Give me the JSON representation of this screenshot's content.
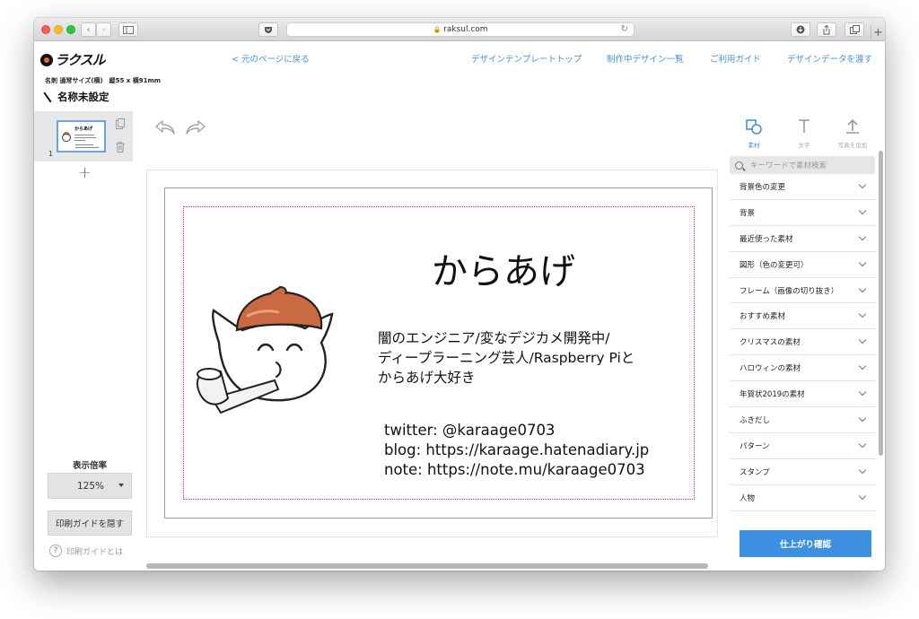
{
  "browser": {
    "url": "raksul.com"
  },
  "header": {
    "logo_text": "ラクスル",
    "back_link": "< 元のページに戻る",
    "nav": [
      "デザインテンプレートトップ",
      "制作中デザイン一覧",
      "ご利用ガイド",
      "デザインデータを渡す"
    ],
    "product": "名刺 通常サイズ(横)　縦55 x 横91mm",
    "design_title": "名称未設定"
  },
  "pages": {
    "thumb_title": "からあげ",
    "page_number": "1",
    "add_symbol": "+"
  },
  "zoom": {
    "label": "表示倍率",
    "value": "125%"
  },
  "guide": {
    "hide_button": "印刷ガイドを隠す",
    "help_link": "印刷ガイドとは"
  },
  "card": {
    "title": "からあげ",
    "bio": [
      "闇のエンジニア/変なデジカメ開発中/",
      "ディープラーニング芸人/Raspberry Piと",
      "からあげ大好き"
    ],
    "links": [
      "twitter: @karaage0703",
      "blog: https://karaage.hatenadiary.jp",
      "note: https://note.mu/karaage0703"
    ]
  },
  "right_panel": {
    "tabs": [
      {
        "label": "素材",
        "icon": "shapes-icon",
        "active": true
      },
      {
        "label": "文字",
        "icon": "text-icon",
        "active": false
      },
      {
        "label": "写真を追加",
        "icon": "upload-icon",
        "active": false
      }
    ],
    "search_placeholder": "キーワードで素材検索",
    "categories": [
      "背景色の変更",
      "背景",
      "最近使った素材",
      "図形（色の変更可）",
      "フレーム（画像の切り抜き）",
      "おすすめ素材",
      "クリスマスの素材",
      "ハロウィンの素材",
      "年賀状2019の素材",
      "ふきだし",
      "パターン",
      "スタンプ",
      "人物"
    ],
    "confirm_button": "仕上がり確認"
  },
  "colors": {
    "accent": "#4a90d2",
    "confirm": "#3d8fe0",
    "cap": "#c96a43"
  }
}
